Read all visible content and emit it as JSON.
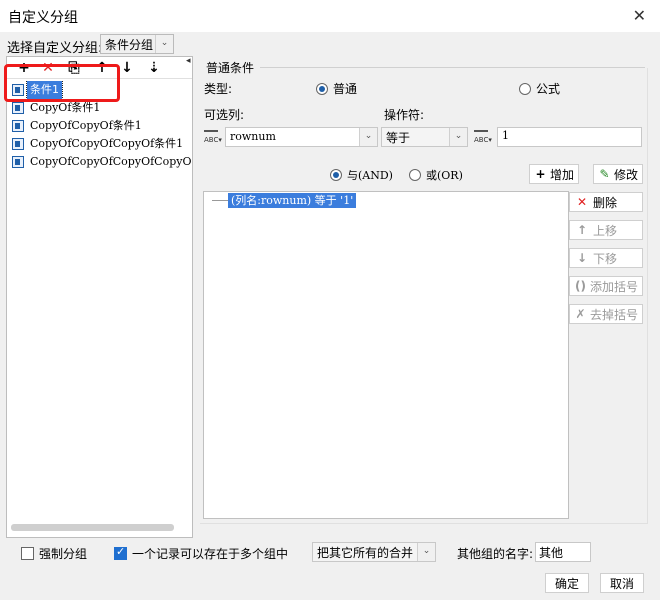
{
  "window": {
    "title": "自定义分组",
    "close_glyph": "✕"
  },
  "group_selector": {
    "label": "选择自定义分组:",
    "value": "条件分组",
    "arrow": "⌄"
  },
  "toolbar_icons": [
    {
      "name": "add-icon",
      "glyph": "+",
      "color": "#222222"
    },
    {
      "name": "delete-icon",
      "glyph": "✕",
      "color": "#e02020"
    },
    {
      "name": "copy-icon",
      "glyph": "⎘",
      "color": "#333333"
    },
    {
      "name": "move-up-icon",
      "glyph": "↑",
      "color": "#222222"
    },
    {
      "name": "move-down-icon",
      "glyph": "↓",
      "color": "#222222"
    },
    {
      "name": "sort-icon",
      "glyph": "⇣",
      "color": "#222222"
    }
  ],
  "group_list": [
    "条件1",
    "CopyOf条件1",
    "CopyOfCopyOf条件1",
    "CopyOfCopyOfCopyOf条件1",
    "CopyOfCopyOfCopyOfCopyOf条"
  ],
  "selected_index": 0,
  "condition": {
    "section_title": "普通条件",
    "type_label": "类型:",
    "type_normal": "普通",
    "type_formula": "公式",
    "column_label": "可选列:",
    "operator_label": "操作符:",
    "column_value": "rownum",
    "operator_value": "等于",
    "value": "1",
    "and_label": "与(AND)",
    "or_label": "或(OR)",
    "add_label": "增加",
    "modify_label": "修改",
    "expression": "(列名:rownum) 等于 '1'"
  },
  "side_buttons": {
    "delete": "删除",
    "up": "上移",
    "down": "下移",
    "add_paren": "添加括号",
    "remove_paren": "去掉括号"
  },
  "bottom": {
    "force_group": "强制分组",
    "multi_group": "一个记录可以存在于多个组中",
    "merge_value": "把其它所有的合并",
    "other_name_label": "其他组的名字:",
    "other_name_value": "其他",
    "ok": "确定",
    "cancel": "取消"
  },
  "colors": {
    "accent": "#3b7ddd",
    "highlight": "#ee1a1a",
    "delete": "#e02020"
  }
}
